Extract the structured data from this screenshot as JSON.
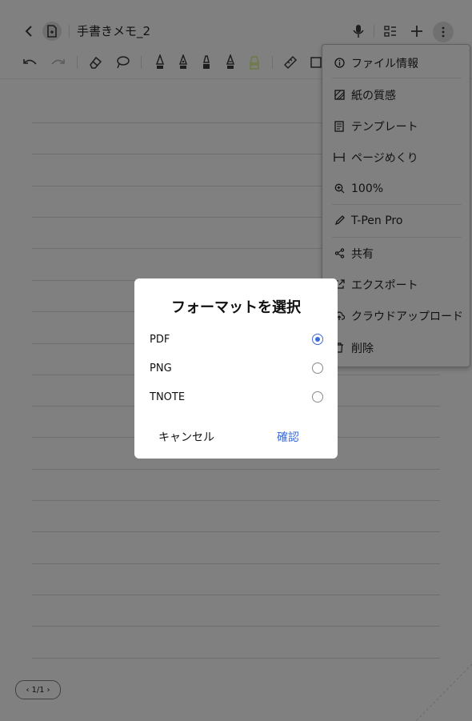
{
  "header": {
    "title": "手書きメモ_2"
  },
  "menu": {
    "items": [
      {
        "label": "ファイル情報",
        "icon": "info-icon"
      },
      {
        "label": "紙の質感",
        "icon": "texture-icon"
      },
      {
        "label": "テンプレート",
        "icon": "template-icon"
      },
      {
        "label": "ページめくり",
        "icon": "page-flip-icon"
      },
      {
        "label": "100%",
        "icon": "zoom-icon"
      },
      {
        "label": "T-Pen Pro",
        "icon": "pen-icon"
      },
      {
        "label": "共有",
        "icon": "share-icon"
      },
      {
        "label": "エクスポート",
        "icon": "export-icon"
      },
      {
        "label": "クラウドアップロード",
        "icon": "cloud-upload-icon"
      },
      {
        "label": "削除",
        "icon": "delete-icon"
      }
    ]
  },
  "dialog": {
    "title": "フォーマットを選択",
    "options": [
      {
        "label": "PDF",
        "selected": true
      },
      {
        "label": "PNG",
        "selected": false
      },
      {
        "label": "TNOTE",
        "selected": false
      }
    ],
    "cancel_label": "キャンセル",
    "confirm_label": "確認"
  },
  "pager": {
    "label": "1/1"
  },
  "colors": {
    "overlay_background": "#808080",
    "dialog_background": "#ffffff",
    "accent": "#3b6bd6"
  }
}
